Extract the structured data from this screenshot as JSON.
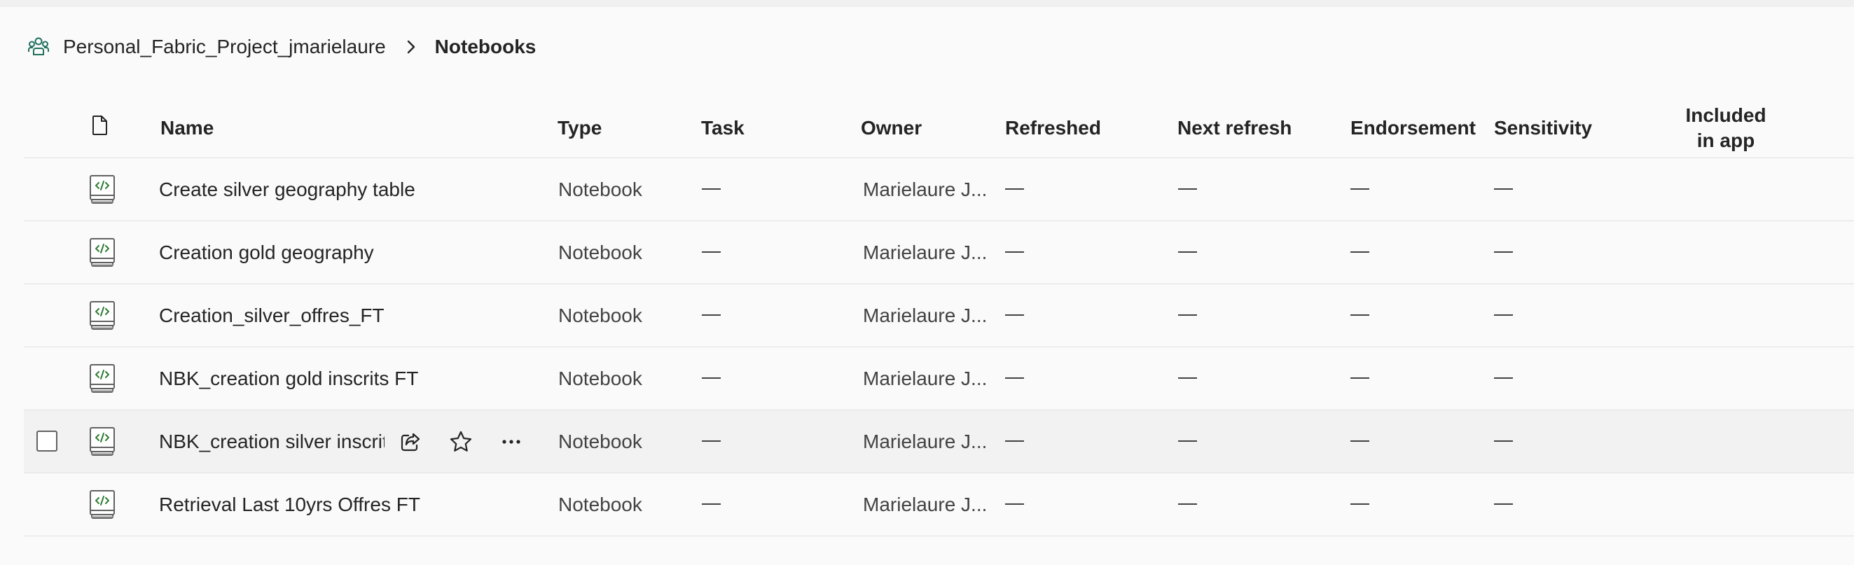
{
  "breadcrumb": {
    "workspace_icon": "workspace-people-icon",
    "workspace": "Personal_Fabric_Project_jmarielaure",
    "separator_icon": "chevron-right-icon",
    "current": "Notebooks"
  },
  "table": {
    "columns": {
      "type_icon": "file-icon",
      "name": "Name",
      "type": "Type",
      "task": "Task",
      "owner": "Owner",
      "refreshed": "Refreshed",
      "next_refresh": "Next refresh",
      "endorsement": "Endorsement",
      "sensitivity": "Sensitivity",
      "included_line1": "Included",
      "included_line2": "in app"
    },
    "rows": [
      {
        "icon": "notebook-icon",
        "name": "Create silver geography table",
        "type": "Notebook",
        "task": "—",
        "owner": "Marielaure J...",
        "refreshed": "—",
        "next_refresh": "—",
        "endorsement": "—",
        "sensitivity": "—"
      },
      {
        "icon": "notebook-icon",
        "name": "Creation gold geography",
        "type": "Notebook",
        "task": "—",
        "owner": "Marielaure J...",
        "refreshed": "—",
        "next_refresh": "—",
        "endorsement": "—",
        "sensitivity": "—"
      },
      {
        "icon": "notebook-icon",
        "name": "Creation_silver_offres_FT",
        "type": "Notebook",
        "task": "—",
        "owner": "Marielaure J...",
        "refreshed": "—",
        "next_refresh": "—",
        "endorsement": "—",
        "sensitivity": "—"
      },
      {
        "icon": "notebook-icon",
        "name": "NBK_creation gold inscrits FT",
        "type": "Notebook",
        "task": "—",
        "owner": "Marielaure J...",
        "refreshed": "—",
        "next_refresh": "—",
        "endorsement": "—",
        "sensitivity": "—"
      },
      {
        "icon": "notebook-icon",
        "name": "NBK_creation silver inscrits",
        "type": "Notebook",
        "task": "—",
        "owner": "Marielaure J...",
        "refreshed": "—",
        "next_refresh": "—",
        "endorsement": "—",
        "sensitivity": "—",
        "hovered": true,
        "actions": [
          "share-icon",
          "star-icon",
          "more-options-icon"
        ]
      },
      {
        "icon": "notebook-icon",
        "name": "Retrieval Last 10yrs Offres FT",
        "type": "Notebook",
        "task": "—",
        "owner": "Marielaure J...",
        "refreshed": "—",
        "next_refresh": "—",
        "endorsement": "—",
        "sensitivity": "—"
      }
    ]
  },
  "colors": {
    "background": "#fafafa",
    "text": "#242424",
    "divider": "#e1e1e1",
    "hover_row": "#f2f2f2",
    "notebook_accent": "#2e7d32"
  }
}
